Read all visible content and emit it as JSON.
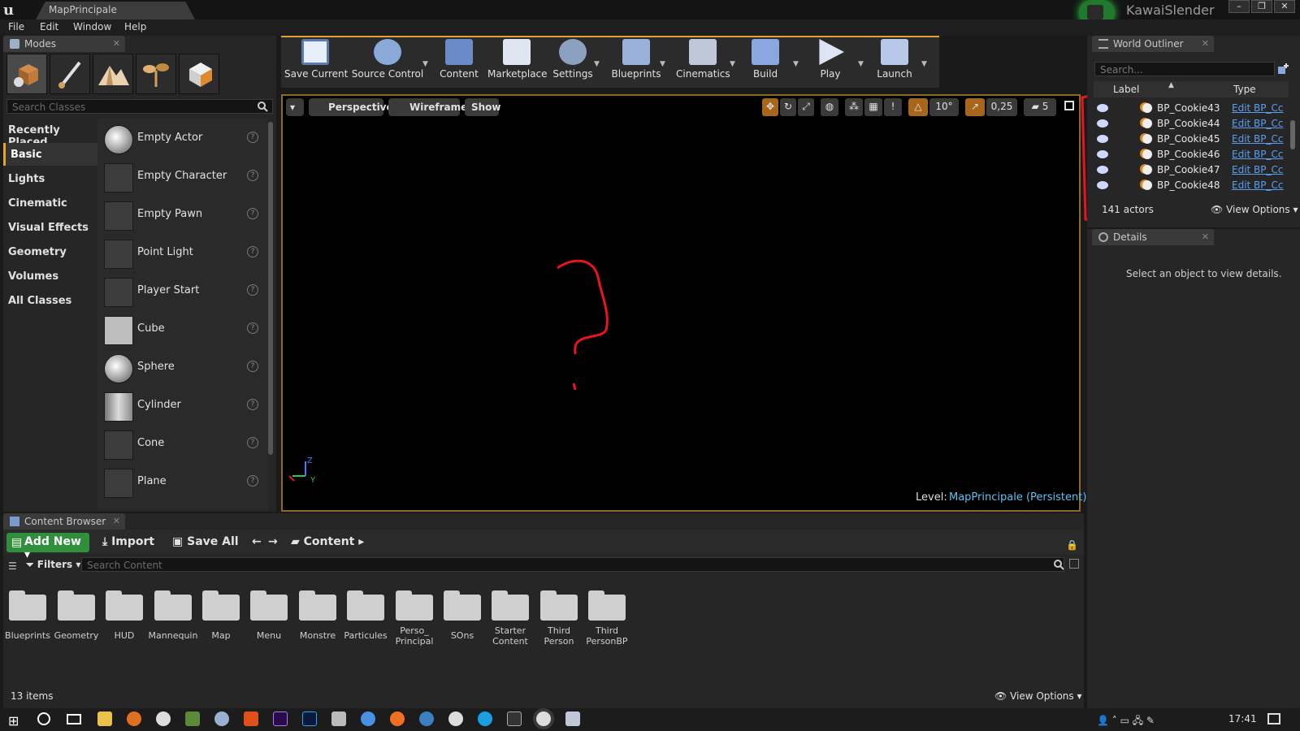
{
  "window": {
    "doc_tab": "MapPrincipale",
    "user_name": "KawaiSlender",
    "logo": "u"
  },
  "menu": [
    "File",
    "Edit",
    "Window",
    "Help"
  ],
  "modes": {
    "tab_label": "Modes",
    "search_placeholder": "Search Classes",
    "categories": [
      "Recently Placed",
      "Basic",
      "Lights",
      "Cinematic",
      "Visual Effects",
      "Geometry",
      "Volumes",
      "All Classes"
    ],
    "active_category": "Basic",
    "place_items": [
      "Empty Actor",
      "Empty Character",
      "Empty Pawn",
      "Point Light",
      "Player Start",
      "Cube",
      "Sphere",
      "Cylinder",
      "Cone",
      "Plane"
    ]
  },
  "toolbar": {
    "buttons": [
      "Save Current",
      "Source Control",
      "Content",
      "Marketplace",
      "Settings",
      "Blueprints",
      "Cinematics",
      "Build",
      "Play",
      "Launch"
    ]
  },
  "viewport": {
    "buttons": [
      "Perspective",
      "Wireframe",
      "Show"
    ],
    "rotation_snap": "10°",
    "scale_snap": "0,25",
    "camera_speed": "5",
    "level_label": "Level:",
    "level_value": "MapPrincipale (Persistent)",
    "axis_y": "Y",
    "axis_z": "Z"
  },
  "outliner": {
    "tab_label": "World Outliner",
    "search_placeholder": "Search...",
    "col_label": "Label",
    "col_type": "Type",
    "rows": [
      {
        "label": "BP_Cookie43",
        "type": "Edit BP_Cc"
      },
      {
        "label": "BP_Cookie44",
        "type": "Edit BP_Cc"
      },
      {
        "label": "BP_Cookie45",
        "type": "Edit BP_Cc"
      },
      {
        "label": "BP_Cookie46",
        "type": "Edit BP_Cc"
      },
      {
        "label": "BP_Cookie47",
        "type": "Edit BP_Cc"
      },
      {
        "label": "BP_Cookie48",
        "type": "Edit BP_Cc"
      }
    ],
    "actors_count": "141 actors",
    "view_options": "View Options"
  },
  "details": {
    "tab_label": "Details",
    "message": "Select an object to view details."
  },
  "content_browser": {
    "tab_label": "Content Browser",
    "add_new": "Add New",
    "import": "Import",
    "save_all": "Save All",
    "path": "Content",
    "filters": "Filters",
    "search_placeholder": "Search Content",
    "folders": [
      "Blueprints",
      "Geometry",
      "HUD",
      "Mannequin",
      "Map",
      "Menu",
      "Monstre",
      "Particules",
      "Perso_ Principal",
      "SOns",
      "Starter Content",
      "Third Person",
      "Third PersonBP"
    ],
    "items_count": "13 items",
    "view_options": "View Options"
  },
  "taskbar": {
    "clock": "17:41"
  },
  "colors": {
    "accent": "#e0a42a",
    "add_new_green": "#2f8f3a",
    "link_blue": "#5a9ef0",
    "annotation_red": "#e8141e"
  }
}
